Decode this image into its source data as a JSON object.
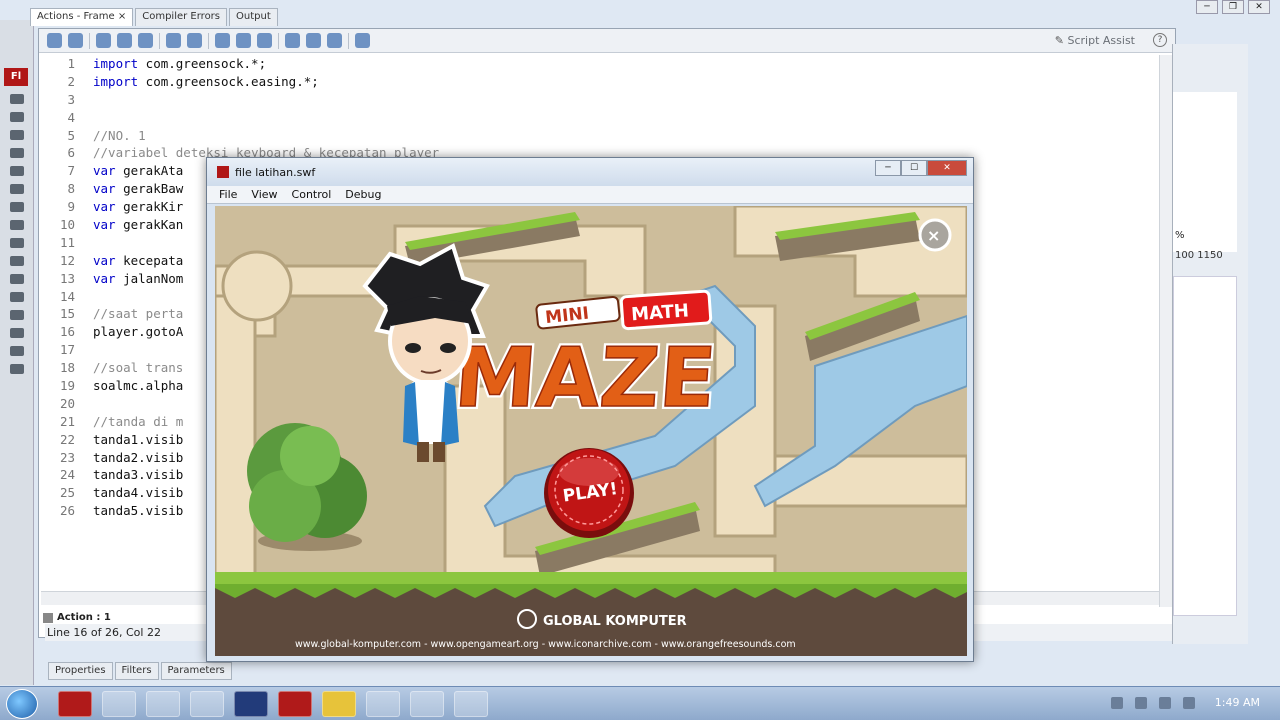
{
  "tabs": [
    {
      "label": "Actions - Frame",
      "close": "×"
    },
    {
      "label": "Compiler Errors"
    },
    {
      "label": "Output"
    }
  ],
  "editor": {
    "script_assist": "Script Assist",
    "help": "?",
    "lines": [
      {
        "n": "1",
        "kind": "code",
        "kw": "import",
        "text": " com.greensock.*;"
      },
      {
        "n": "2",
        "kind": "code",
        "kw": "import",
        "text": " com.greensock.easing.*;"
      },
      {
        "n": "3",
        "kind": "code",
        "kw": "",
        "text": ""
      },
      {
        "n": "4",
        "kind": "code",
        "kw": "",
        "text": ""
      },
      {
        "n": "5",
        "kind": "comment",
        "kw": "",
        "text": "//NO. 1"
      },
      {
        "n": "6",
        "kind": "comment",
        "kw": "",
        "text": "//variabel deteksi keyboard & kecepatan player"
      },
      {
        "n": "7",
        "kind": "code",
        "kw": "var",
        "text": " gerakAta"
      },
      {
        "n": "8",
        "kind": "code",
        "kw": "var",
        "text": " gerakBaw"
      },
      {
        "n": "9",
        "kind": "code",
        "kw": "var",
        "text": " gerakKir"
      },
      {
        "n": "10",
        "kind": "code",
        "kw": "var",
        "text": " gerakKan"
      },
      {
        "n": "11",
        "kind": "code",
        "kw": "",
        "text": ""
      },
      {
        "n": "12",
        "kind": "code",
        "kw": "var",
        "text": " kecepata"
      },
      {
        "n": "13",
        "kind": "code",
        "kw": "var",
        "text": " jalanNom"
      },
      {
        "n": "14",
        "kind": "code",
        "kw": "",
        "text": ""
      },
      {
        "n": "15",
        "kind": "comment",
        "kw": "",
        "text": "//saat perta"
      },
      {
        "n": "16",
        "kind": "code",
        "kw": "",
        "text": "player.gotoA"
      },
      {
        "n": "17",
        "kind": "code",
        "kw": "",
        "text": ""
      },
      {
        "n": "18",
        "kind": "comment",
        "kw": "",
        "text": "//soal trans"
      },
      {
        "n": "19",
        "kind": "code",
        "kw": "",
        "text": "soalmc.alpha"
      },
      {
        "n": "20",
        "kind": "code",
        "kw": "",
        "text": ""
      },
      {
        "n": "21",
        "kind": "comment",
        "kw": "",
        "text": "//tanda di m"
      },
      {
        "n": "22",
        "kind": "code",
        "kw": "",
        "text": "tanda1.visib"
      },
      {
        "n": "23",
        "kind": "code",
        "kw": "",
        "text": "tanda2.visib"
      },
      {
        "n": "24",
        "kind": "code",
        "kw": "",
        "text": "tanda3.visib"
      },
      {
        "n": "25",
        "kind": "code",
        "kw": "",
        "text": "tanda4.visib"
      },
      {
        "n": "26",
        "kind": "code",
        "kw": "",
        "text": "tanda5.visib"
      }
    ],
    "action_tab": "Action : 1",
    "status": "Line 16 of 26, Col 22"
  },
  "right_panel": {
    "pct": "%",
    "ruler": "100    1150"
  },
  "bottom_tabs": [
    "Properties",
    "Filters",
    "Parameters"
  ],
  "swf": {
    "title": "file latihan.swf",
    "menu": [
      "File",
      "View",
      "Control",
      "Debug"
    ],
    "game": {
      "mini": "MINI",
      "math": "MATH",
      "maze": "MAZE",
      "play": "PLAY!",
      "brand": "GLOBAL KOMPUTER",
      "footer": "www.global-komputer.com - www.opengameart.org - www.iconarchive.com - www.orangefreesounds.com",
      "close": "×"
    }
  },
  "taskbar": {
    "clock": "1:49 AM"
  },
  "colors": {
    "keyword": "#0000c8",
    "comment": "#8a8a8a",
    "grass": "#8cc63f",
    "water": "#9ec9e6",
    "play_red": "#c01515",
    "maze_orange": "#e25f16"
  }
}
